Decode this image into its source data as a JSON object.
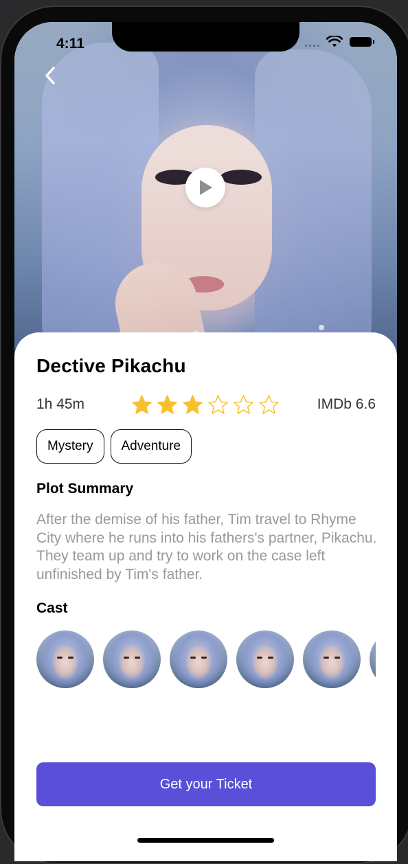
{
  "status_bar": {
    "time": "4:11"
  },
  "movie": {
    "title": "Dective Pikachu",
    "duration": "1h 45m",
    "rating": {
      "filled": 3,
      "total": 6
    },
    "imdb": "IMDb 6.6",
    "genres": [
      "Mystery",
      "Adventure"
    ]
  },
  "plot": {
    "heading": "Plot Summary",
    "text": "After the demise of his father, Tim travel to Rhyme City where he runs into his fathers's partner, Pikachu. They team up and try to work on the case left unfinished by Tim's father."
  },
  "cast": {
    "heading": "Cast",
    "count_visible": 6
  },
  "actions": {
    "ticket_label": "Get your Ticket"
  },
  "colors": {
    "accent": "#5a4fd8",
    "star": "#f7c12d",
    "muted_text": "#999999"
  },
  "icons": {
    "back": "chevron-left-icon",
    "play": "play-icon",
    "star_filled": "star-filled-icon",
    "star_empty": "star-outline-icon",
    "wifi": "wifi-icon",
    "battery": "battery-icon"
  }
}
